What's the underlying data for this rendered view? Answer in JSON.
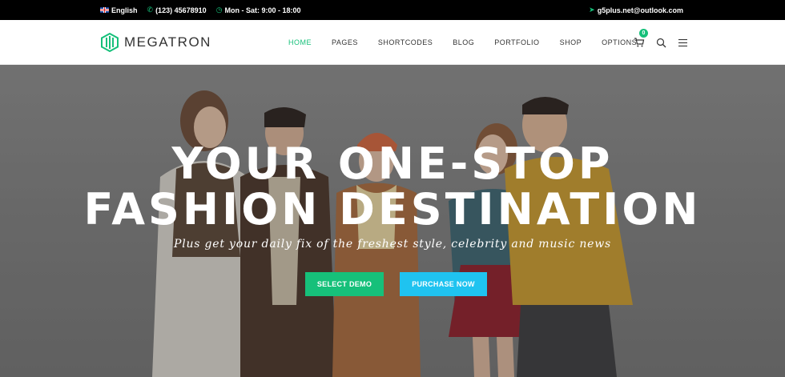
{
  "topbar": {
    "language": "English",
    "phone": "(123) 45678910",
    "hours": "Mon - Sat: 9:00 - 18:00",
    "email": "g5plus.net@outlook.com"
  },
  "header": {
    "logo_text": "MEGATRON",
    "nav": [
      {
        "label": "HOME",
        "active": true
      },
      {
        "label": "PAGES"
      },
      {
        "label": "SHORTCODES"
      },
      {
        "label": "BLOG"
      },
      {
        "label": "PORTFOLIO"
      },
      {
        "label": "SHOP"
      },
      {
        "label": "OPTIONS"
      }
    ],
    "cart_count": "0"
  },
  "hero": {
    "title_line1": "YOUR ONE-STOP",
    "title_line2": "FASHION DESTINATION",
    "subtitle": "Plus get your daily fix of the freshest style, celebrity and music news",
    "btn_demo": "SELECT DEMO",
    "btn_buy": "PURCHASE NOW"
  },
  "colors": {
    "accent": "#16c07a",
    "cyan": "#1fc3f0",
    "topbar_bg": "#000000"
  }
}
